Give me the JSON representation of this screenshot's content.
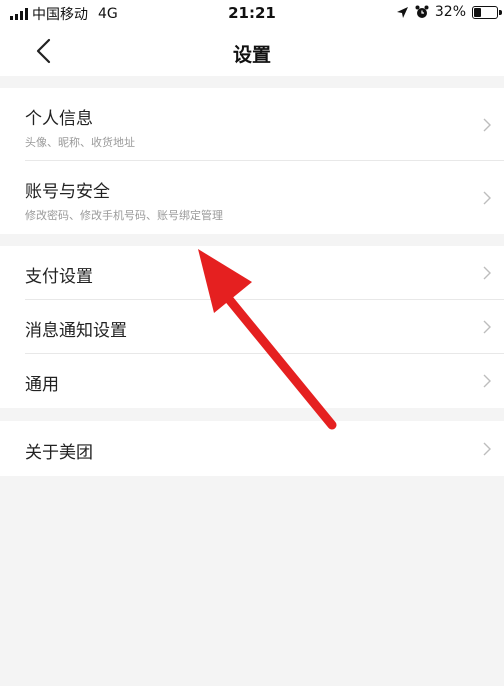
{
  "status_bar": {
    "carrier": "中国移动",
    "network": "4G",
    "time": "21:21",
    "battery": "32%"
  },
  "nav": {
    "title": "设置"
  },
  "groups": [
    {
      "items": [
        {
          "label": "个人信息",
          "subtitle": "头像、昵称、收货地址"
        },
        {
          "label": "账号与安全",
          "subtitle": "修改密码、修改手机号码、账号绑定管理"
        }
      ]
    },
    {
      "items": [
        {
          "label": "支付设置"
        },
        {
          "label": "消息通知设置"
        },
        {
          "label": "通用"
        }
      ]
    },
    {
      "items": [
        {
          "label": "关于美团"
        }
      ]
    }
  ],
  "colors": {
    "background": "#f4f4f4",
    "card": "#ffffff",
    "annotation_arrow": "#e52020"
  }
}
